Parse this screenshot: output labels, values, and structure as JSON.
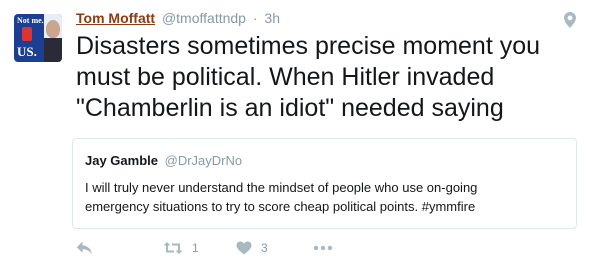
{
  "tweet": {
    "author_name": "Tom Moffatt",
    "author_handle": "@tmoffattndp",
    "separator": "·",
    "time": "3h",
    "avatar_text_top": "Not me.",
    "avatar_text_bottom": "US.",
    "text_lines": [
      "Disasters sometimes precise moment you",
      "must be political. When Hitler invaded",
      "\"Chamberlin is an idiot\" needed saying"
    ]
  },
  "quote": {
    "author_name": "Jay Gamble",
    "author_handle": "@DrJayDrNo",
    "text_lines": [
      "I will truly never understand the mindset of people who use on-going",
      "emergency situations to try to score cheap political points. #ymmfire"
    ]
  },
  "actions": {
    "reply_icon": "reply-icon",
    "retweet_icon": "retweet-icon",
    "retweet_count": "1",
    "like_icon": "heart-icon",
    "like_count": "3",
    "more_icon": "more-icon"
  },
  "colors": {
    "author_name": "#8b3a13",
    "muted": "#8899a6",
    "icon": "#aab8c2",
    "border": "#e1e8ed"
  }
}
